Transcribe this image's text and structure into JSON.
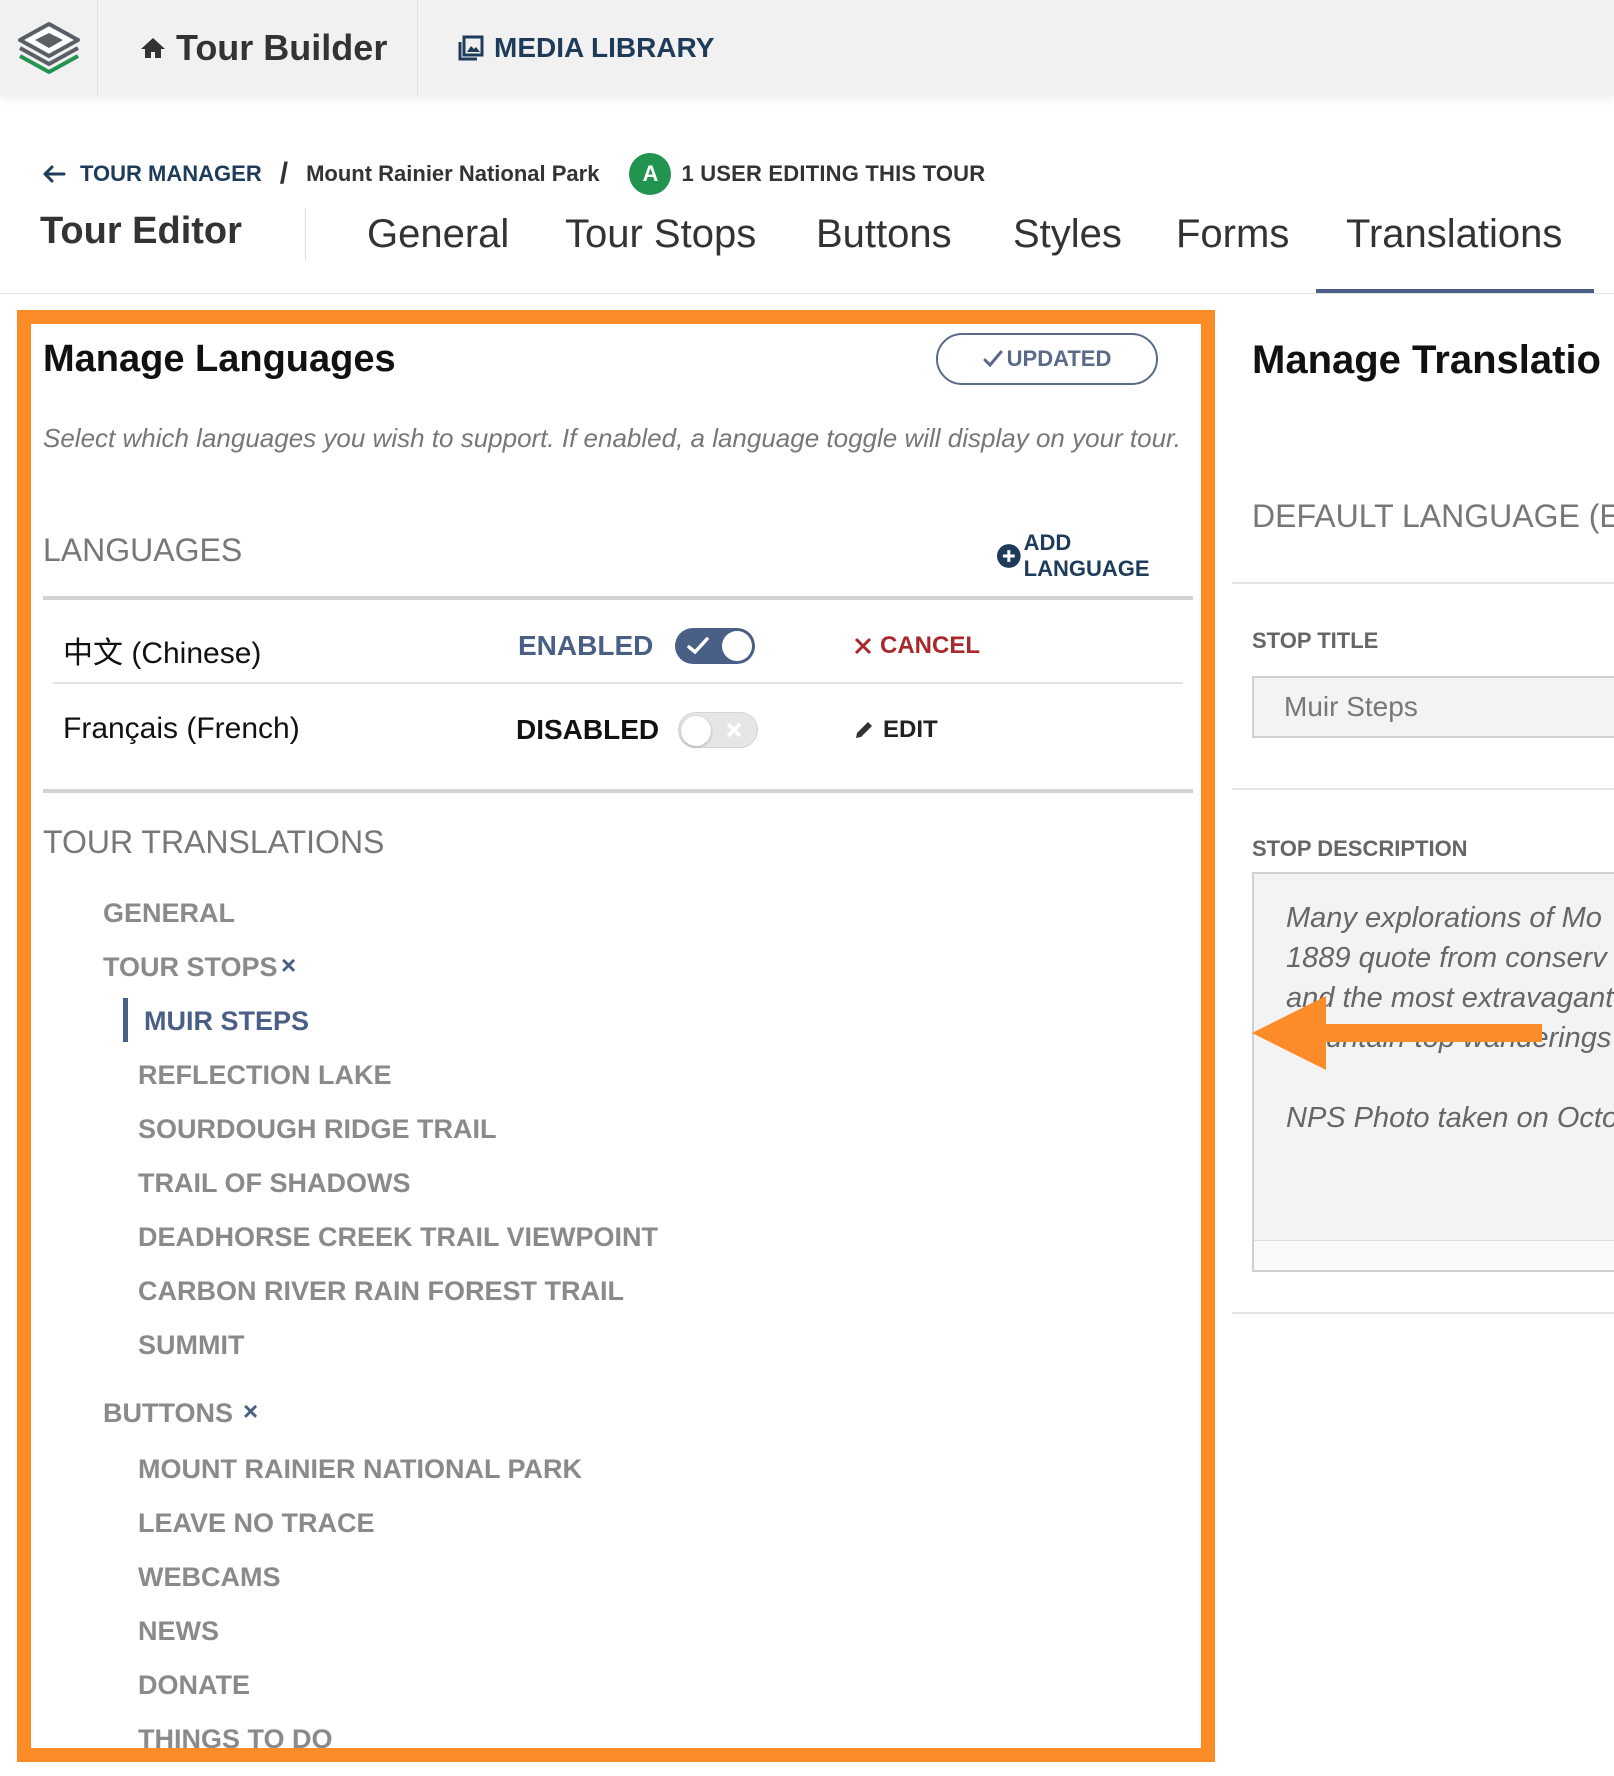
{
  "app": {
    "title": "Tour Builder",
    "media_library": "MEDIA LIBRARY"
  },
  "breadcrumb": {
    "manager": "TOUR MANAGER",
    "separator": "/",
    "tour": "Mount Rainier National Park",
    "avatar_initial": "A",
    "editing": "1 USER EDITING THIS TOUR"
  },
  "editor": {
    "title": "Tour Editor",
    "tabs": [
      {
        "label": "General"
      },
      {
        "label": "Tour Stops"
      },
      {
        "label": "Buttons"
      },
      {
        "label": "Styles"
      },
      {
        "label": "Forms"
      },
      {
        "label": "Translations",
        "active": true
      }
    ]
  },
  "languages_panel": {
    "title": "Manage Languages",
    "updated_label": "UPDATED",
    "description": "Select which languages you wish to support. If enabled, a language toggle will display on your tour.",
    "languages_heading": "LANGUAGES",
    "add_language": "ADD LANGUAGE",
    "languages": [
      {
        "name": "中文 (Chinese)",
        "status": "ENABLED",
        "enabled": true,
        "action": "CANCEL"
      },
      {
        "name": "Français (French)",
        "status": "DISABLED",
        "enabled": false,
        "action": "EDIT"
      }
    ],
    "translations_heading": "TOUR TRANSLATIONS",
    "tree": {
      "general": "GENERAL",
      "tour_stops": {
        "label": "TOUR STOPS",
        "close": "×",
        "items": [
          "MUIR STEPS",
          "REFLECTION LAKE",
          "SOURDOUGH RIDGE TRAIL",
          "TRAIL OF SHADOWS",
          "DEADHORSE CREEK TRAIL VIEWPOINT",
          "CARBON RIVER RAIN FOREST TRAIL",
          "SUMMIT"
        ]
      },
      "buttons": {
        "label": "BUTTONS",
        "close": "×",
        "items": [
          "MOUNT RAINIER NATIONAL PARK",
          "LEAVE NO TRACE",
          "WEBCAMS",
          "NEWS",
          "DONATE",
          "THINGS TO DO"
        ]
      }
    }
  },
  "translations_panel": {
    "title": "Manage Translatio",
    "default_language": "DEFAULT LANGUAGE (EN",
    "stop_title_label": "STOP TITLE",
    "stop_title_value": "Muir Steps",
    "stop_description_label": "STOP DESCRIPTION",
    "description_lines": [
      "Many explorations of Mo",
      "1889 quote from conserv",
      "and the most extravagant",
      "untain-top wanderings",
      "NPS Photo taken on Octo"
    ]
  },
  "colors": {
    "accent_orange": "#fb8c28",
    "navy": "#1e3c5a",
    "slate": "#4a5f86",
    "cancel_red": "#a8282c",
    "avatar_green": "#22944f"
  }
}
